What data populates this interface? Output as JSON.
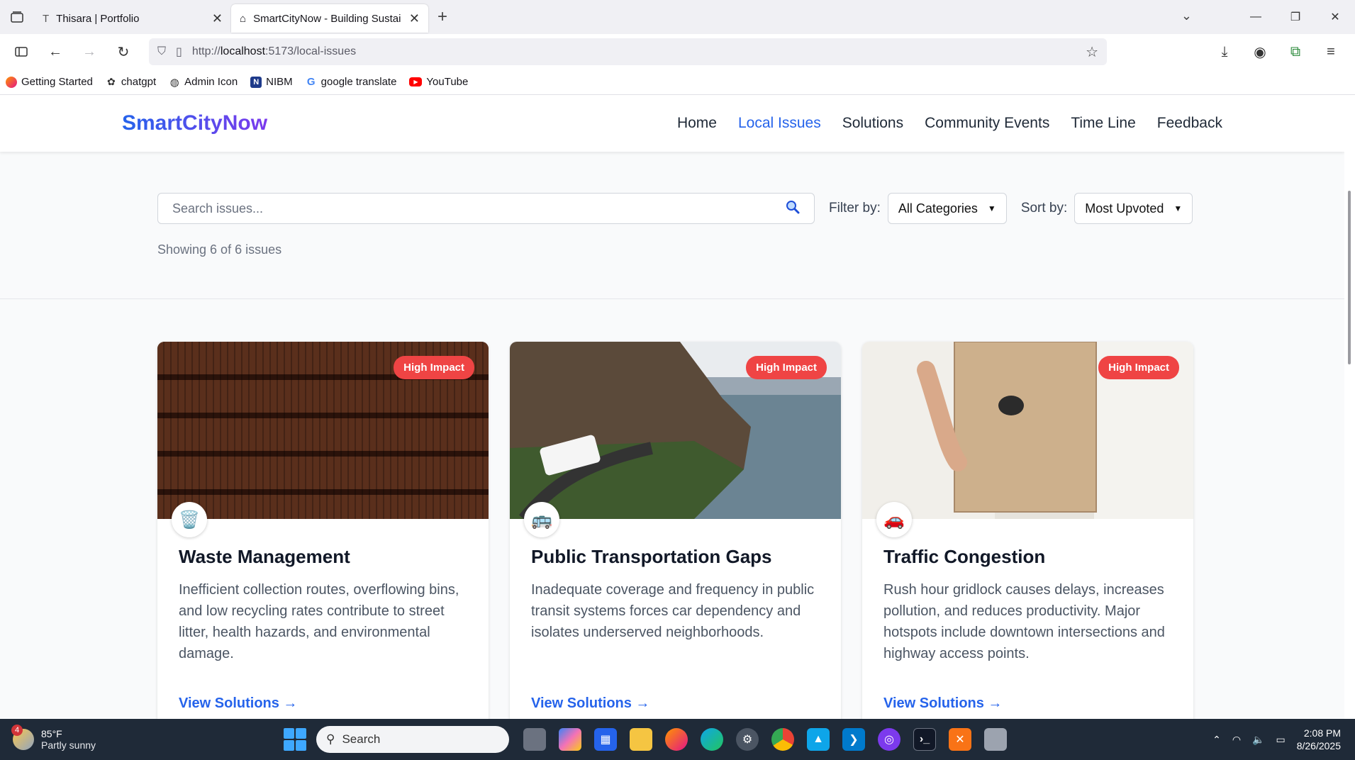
{
  "browser": {
    "tabs": [
      {
        "title": "Thisara | Portfolio",
        "active": false
      },
      {
        "title": "SmartCityNow - Building Sustai",
        "active": true
      }
    ],
    "url_prefix": "http://",
    "url_host": "localhost",
    "url_rest": ":5173/local-issues",
    "bookmarks": [
      {
        "label": "Getting Started",
        "icon": "firefox-icon"
      },
      {
        "label": "chatgpt",
        "icon": "chatgpt-icon"
      },
      {
        "label": "Admin Icon",
        "icon": "globe-icon"
      },
      {
        "label": "NIBM",
        "icon": "nibm-icon"
      },
      {
        "label": "google translate",
        "icon": "google-icon"
      },
      {
        "label": "YouTube",
        "icon": "youtube-icon"
      }
    ]
  },
  "site": {
    "logo": "SmartCityNow",
    "nav": [
      "Home",
      "Local Issues",
      "Solutions",
      "Community Events",
      "Time Line",
      "Feedback"
    ],
    "active_nav": "Local Issues"
  },
  "filters": {
    "search_placeholder": "Search issues...",
    "filter_label": "Filter by:",
    "filter_value": "All Categories",
    "sort_label": "Sort by:",
    "sort_value": "Most Upvoted",
    "showing": "Showing 6 of 6 issues"
  },
  "cards": [
    {
      "badge": "High Impact",
      "icon": "🗑️",
      "icon_name": "trash-icon",
      "title": "Waste Management",
      "desc": "Inefficient collection routes, overflowing bins, and low recycling rates contribute to street litter, health hazards, and environmental damage.",
      "link": "View Solutions →"
    },
    {
      "badge": "High Impact",
      "icon": "🚌",
      "icon_name": "bus-icon",
      "title": "Public Transportation Gaps",
      "desc": "Inadequate coverage and frequency in public transit systems forces car dependency and isolates underserved neighborhoods.",
      "link": "View Solutions →"
    },
    {
      "badge": "High Impact",
      "icon": "🚗",
      "icon_name": "car-icon",
      "title": "Traffic Congestion",
      "desc": "Rush hour gridlock causes delays, increases pollution, and reduces productivity. Major hotspots include downtown intersections and highway access points.",
      "link": "View Solutions →"
    }
  ],
  "taskbar": {
    "weather_badge": "4",
    "temperature": "85°F",
    "condition": "Partly sunny",
    "search": "Search",
    "time": "2:08 PM",
    "date": "8/26/2025"
  },
  "colors": {
    "accent": "#2563eb",
    "badge": "#ef4444"
  }
}
